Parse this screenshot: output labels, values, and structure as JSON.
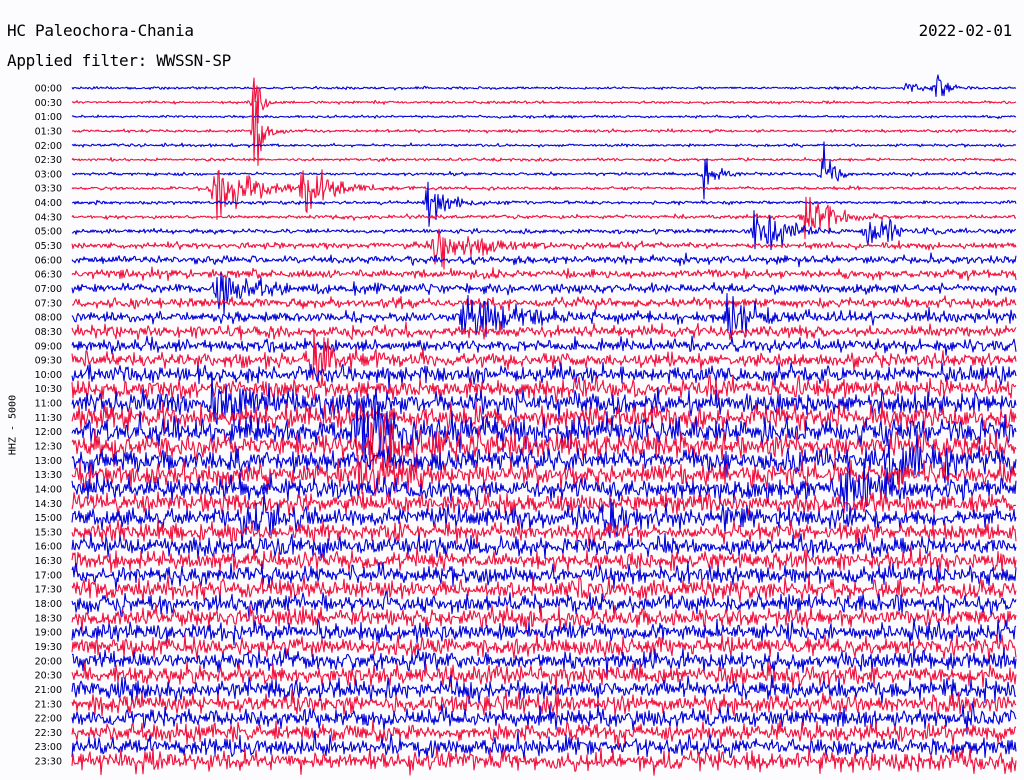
{
  "header": {
    "station": "HC Paleochora-Chania",
    "date": "2022-02-01",
    "filter": "Applied filter: WWSSN-SP"
  },
  "chart_data": {
    "type": "line",
    "title": "HC Paleochora-Chania",
    "ylabel": "HHZ - 5000",
    "row_labels": [
      "00:00",
      "00:30",
      "01:00",
      "01:30",
      "02:00",
      "02:30",
      "03:00",
      "03:30",
      "04:00",
      "04:30",
      "05:00",
      "05:30",
      "06:00",
      "06:30",
      "07:00",
      "07:30",
      "08:00",
      "08:30",
      "09:00",
      "09:30",
      "10:00",
      "10:30",
      "11:00",
      "11:30",
      "12:00",
      "12:30",
      "13:00",
      "13:30",
      "14:00",
      "14:30",
      "15:00",
      "15:30",
      "16:00",
      "16:30",
      "17:00",
      "17:30",
      "18:00",
      "18:30",
      "19:00",
      "19:30",
      "20:00",
      "20:30",
      "21:00",
      "21:30",
      "22:00",
      "22:30",
      "23:00",
      "23:30"
    ],
    "series_colors": [
      "#0000d8",
      "#f0103c"
    ],
    "noise_level": [
      0.8,
      0.8,
      0.8,
      0.9,
      0.9,
      0.9,
      1.0,
      1.0,
      1.1,
      1.2,
      1.5,
      2.0,
      2.5,
      2.8,
      3.0,
      3.2,
      3.5,
      3.8,
      4.0,
      4.5,
      5.5,
      6.5,
      7.0,
      7.5,
      8.0,
      8.0,
      7.5,
      7.0,
      7.0,
      6.5,
      6.5,
      6.0,
      6.0,
      6.0,
      6.0,
      6.0,
      6.0,
      6.0,
      6.0,
      6.0,
      6.0,
      6.0,
      6.0,
      6.0,
      6.0,
      6.0,
      6.0,
      6.0
    ],
    "events": [
      {
        "row": 0,
        "minute": 26.5,
        "amplitude": 5,
        "width": 0.4
      },
      {
        "row": 0,
        "minute": 27.5,
        "amplitude": 9,
        "width": 0.3
      },
      {
        "row": 1,
        "minute": 5.8,
        "amplitude": 48,
        "width": 0.15
      },
      {
        "row": 3,
        "minute": 5.8,
        "amplitude": 50,
        "width": 0.2
      },
      {
        "row": 6,
        "minute": 23.8,
        "amplitude": 26,
        "width": 0.3
      },
      {
        "row": 6,
        "minute": 20.1,
        "amplitude": 22,
        "width": 0.3
      },
      {
        "row": 7,
        "minute": 4.5,
        "amplitude": 24,
        "width": 1.0
      },
      {
        "row": 7,
        "minute": 7.3,
        "amplitude": 20,
        "width": 0.8
      },
      {
        "row": 8,
        "minute": 11.3,
        "amplitude": 22,
        "width": 0.5
      },
      {
        "row": 9,
        "minute": 23.3,
        "amplitude": 25,
        "width": 0.6
      },
      {
        "row": 10,
        "minute": 21.7,
        "amplitude": 18,
        "width": 0.8
      },
      {
        "row": 10,
        "minute": 25.3,
        "amplitude": 15,
        "width": 0.6
      },
      {
        "row": 11,
        "minute": 11.5,
        "amplitude": 20,
        "width": 1.0
      },
      {
        "row": 14,
        "minute": 4.6,
        "amplitude": 18,
        "width": 1.0
      },
      {
        "row": 16,
        "minute": 12.4,
        "amplitude": 20,
        "width": 1.0
      },
      {
        "row": 16,
        "minute": 20.8,
        "amplitude": 15,
        "width": 0.8
      },
      {
        "row": 19,
        "minute": 7.6,
        "amplitude": 15,
        "width": 0.8
      },
      {
        "row": 22,
        "minute": 4.4,
        "amplitude": 15,
        "width": 1.0
      },
      {
        "row": 24,
        "minute": 9.0,
        "amplitude": 20,
        "width": 1.5
      },
      {
        "row": 25,
        "minute": 9.5,
        "amplitude": 18,
        "width": 1.5
      },
      {
        "row": 26,
        "minute": 26.0,
        "amplitude": 18,
        "width": 1.0
      },
      {
        "row": 27,
        "minute": 9.0,
        "amplitude": 15,
        "width": 1.0
      },
      {
        "row": 28,
        "minute": 24.4,
        "amplitude": 18,
        "width": 1.0
      },
      {
        "row": 30,
        "minute": 5.4,
        "amplitude": 15,
        "width": 0.8
      },
      {
        "row": 30,
        "minute": 16.8,
        "amplitude": 12,
        "width": 0.8
      }
    ]
  }
}
